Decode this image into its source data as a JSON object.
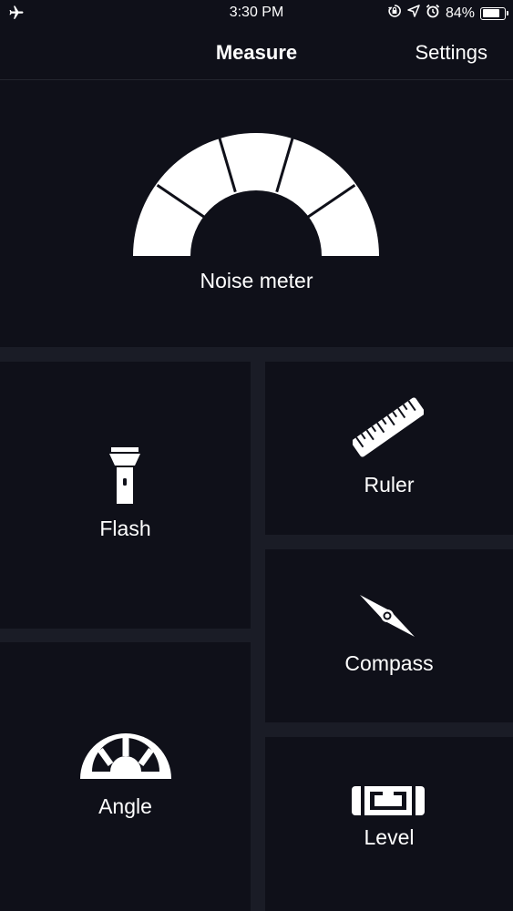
{
  "status_bar": {
    "time": "3:30 PM",
    "battery_percent_label": "84%",
    "battery_level": 0.84,
    "icons": [
      "airplane-icon",
      "screen-lock-rotation-icon",
      "location-arrow-icon",
      "alarm-icon",
      "battery-icon"
    ]
  },
  "nav": {
    "title": "Measure",
    "settings_label": "Settings"
  },
  "tiles": {
    "noise_meter": {
      "label": "Noise meter",
      "icon": "noise-meter-gauge-icon"
    },
    "flash": {
      "label": "Flash",
      "icon": "flashlight-icon"
    },
    "ruler": {
      "label": "Ruler",
      "icon": "ruler-icon"
    },
    "compass": {
      "label": "Compass",
      "icon": "compass-needle-icon"
    },
    "angle": {
      "label": "Angle",
      "icon": "protractor-icon"
    },
    "level": {
      "label": "Level",
      "icon": "spirit-level-icon"
    }
  },
  "colors": {
    "background": "#1a1c26",
    "tile": "#0f1019",
    "foreground": "#ffffff"
  }
}
